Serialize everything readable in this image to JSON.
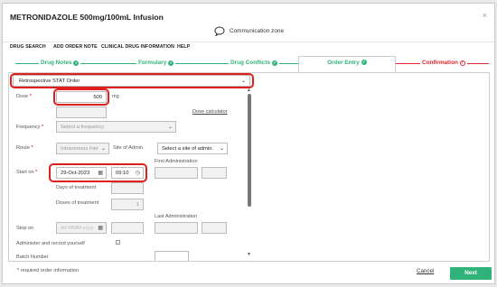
{
  "window": {
    "title": "METRONIDAZOLE 500mg/100mL Infusion",
    "close_label": "×"
  },
  "communication": {
    "label": "Communication zone"
  },
  "menu": [
    "DRUG SEARCH",
    "ADD ORDER NOTE",
    "CLINICAL DRUG INFORMATION",
    "HELP"
  ],
  "steps": {
    "drug_notes": "Drug Notes",
    "formulary": "Formulary",
    "drug_conflicts": "Drug Conflicts",
    "order_entry": "Order Entry",
    "confirmation": "Confirmation"
  },
  "form": {
    "order_type": "Retrospective STAT Order",
    "dose_label": "Dose",
    "dose_value": "500",
    "dose_unit": "mg",
    "dose_calculator": "Dose calculator",
    "frequency_label": "Frequency",
    "frequency_placeholder": "Select a frequency",
    "route_label": "Route",
    "route_value": "Intravenous Inte",
    "site_label": "Site of Admin.",
    "site_placeholder": "Select a site of admin.",
    "first_admin_label": "First Administration",
    "start_label": "Start on",
    "start_date": "29-Oct-2023",
    "start_time": "09:10",
    "days_label": "Days of treatment",
    "doses_label": "Doses of treatment",
    "doses_value": "1",
    "last_admin_label": "Last Administration",
    "stop_label": "Stop on",
    "stop_placeholder": "dd-MMM-yyyy",
    "administer_label": "Administer and record yourself",
    "batch_label": "Batch Number"
  },
  "footer": {
    "required_note": "* required order information.",
    "cancel_label": "Cancel",
    "next_label": "Next"
  },
  "colors": {
    "accent": "#2fb37a",
    "alert": "#e0262b",
    "highlight_box": "#e01e1e"
  }
}
